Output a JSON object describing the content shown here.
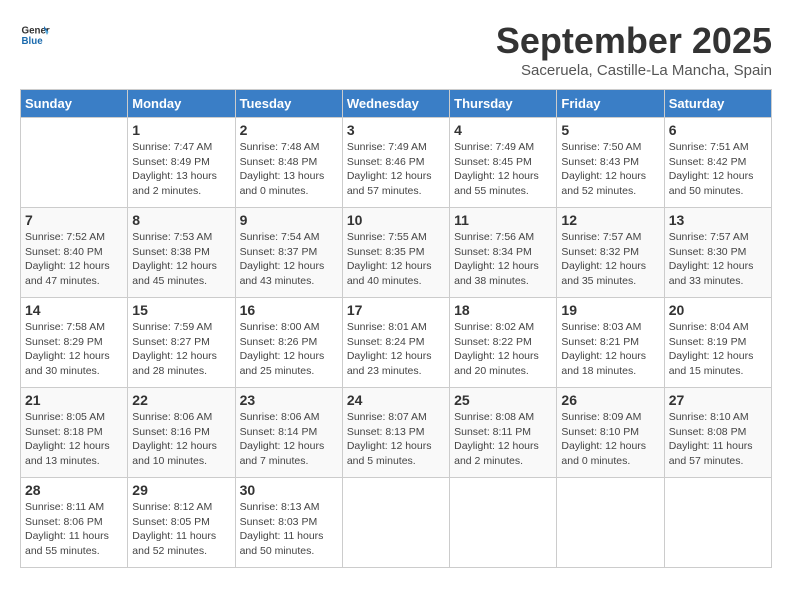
{
  "logo": {
    "line1": "General",
    "line2": "Blue"
  },
  "title": "September 2025",
  "subtitle": "Saceruela, Castille-La Mancha, Spain",
  "days_of_week": [
    "Sunday",
    "Monday",
    "Tuesday",
    "Wednesday",
    "Thursday",
    "Friday",
    "Saturday"
  ],
  "weeks": [
    [
      {
        "day": "",
        "info": ""
      },
      {
        "day": "1",
        "info": "Sunrise: 7:47 AM\nSunset: 8:49 PM\nDaylight: 13 hours\nand 2 minutes."
      },
      {
        "day": "2",
        "info": "Sunrise: 7:48 AM\nSunset: 8:48 PM\nDaylight: 13 hours\nand 0 minutes."
      },
      {
        "day": "3",
        "info": "Sunrise: 7:49 AM\nSunset: 8:46 PM\nDaylight: 12 hours\nand 57 minutes."
      },
      {
        "day": "4",
        "info": "Sunrise: 7:49 AM\nSunset: 8:45 PM\nDaylight: 12 hours\nand 55 minutes."
      },
      {
        "day": "5",
        "info": "Sunrise: 7:50 AM\nSunset: 8:43 PM\nDaylight: 12 hours\nand 52 minutes."
      },
      {
        "day": "6",
        "info": "Sunrise: 7:51 AM\nSunset: 8:42 PM\nDaylight: 12 hours\nand 50 minutes."
      }
    ],
    [
      {
        "day": "7",
        "info": "Sunrise: 7:52 AM\nSunset: 8:40 PM\nDaylight: 12 hours\nand 47 minutes."
      },
      {
        "day": "8",
        "info": "Sunrise: 7:53 AM\nSunset: 8:38 PM\nDaylight: 12 hours\nand 45 minutes."
      },
      {
        "day": "9",
        "info": "Sunrise: 7:54 AM\nSunset: 8:37 PM\nDaylight: 12 hours\nand 43 minutes."
      },
      {
        "day": "10",
        "info": "Sunrise: 7:55 AM\nSunset: 8:35 PM\nDaylight: 12 hours\nand 40 minutes."
      },
      {
        "day": "11",
        "info": "Sunrise: 7:56 AM\nSunset: 8:34 PM\nDaylight: 12 hours\nand 38 minutes."
      },
      {
        "day": "12",
        "info": "Sunrise: 7:57 AM\nSunset: 8:32 PM\nDaylight: 12 hours\nand 35 minutes."
      },
      {
        "day": "13",
        "info": "Sunrise: 7:57 AM\nSunset: 8:30 PM\nDaylight: 12 hours\nand 33 minutes."
      }
    ],
    [
      {
        "day": "14",
        "info": "Sunrise: 7:58 AM\nSunset: 8:29 PM\nDaylight: 12 hours\nand 30 minutes."
      },
      {
        "day": "15",
        "info": "Sunrise: 7:59 AM\nSunset: 8:27 PM\nDaylight: 12 hours\nand 28 minutes."
      },
      {
        "day": "16",
        "info": "Sunrise: 8:00 AM\nSunset: 8:26 PM\nDaylight: 12 hours\nand 25 minutes."
      },
      {
        "day": "17",
        "info": "Sunrise: 8:01 AM\nSunset: 8:24 PM\nDaylight: 12 hours\nand 23 minutes."
      },
      {
        "day": "18",
        "info": "Sunrise: 8:02 AM\nSunset: 8:22 PM\nDaylight: 12 hours\nand 20 minutes."
      },
      {
        "day": "19",
        "info": "Sunrise: 8:03 AM\nSunset: 8:21 PM\nDaylight: 12 hours\nand 18 minutes."
      },
      {
        "day": "20",
        "info": "Sunrise: 8:04 AM\nSunset: 8:19 PM\nDaylight: 12 hours\nand 15 minutes."
      }
    ],
    [
      {
        "day": "21",
        "info": "Sunrise: 8:05 AM\nSunset: 8:18 PM\nDaylight: 12 hours\nand 13 minutes."
      },
      {
        "day": "22",
        "info": "Sunrise: 8:06 AM\nSunset: 8:16 PM\nDaylight: 12 hours\nand 10 minutes."
      },
      {
        "day": "23",
        "info": "Sunrise: 8:06 AM\nSunset: 8:14 PM\nDaylight: 12 hours\nand 7 minutes."
      },
      {
        "day": "24",
        "info": "Sunrise: 8:07 AM\nSunset: 8:13 PM\nDaylight: 12 hours\nand 5 minutes."
      },
      {
        "day": "25",
        "info": "Sunrise: 8:08 AM\nSunset: 8:11 PM\nDaylight: 12 hours\nand 2 minutes."
      },
      {
        "day": "26",
        "info": "Sunrise: 8:09 AM\nSunset: 8:10 PM\nDaylight: 12 hours\nand 0 minutes."
      },
      {
        "day": "27",
        "info": "Sunrise: 8:10 AM\nSunset: 8:08 PM\nDaylight: 11 hours\nand 57 minutes."
      }
    ],
    [
      {
        "day": "28",
        "info": "Sunrise: 8:11 AM\nSunset: 8:06 PM\nDaylight: 11 hours\nand 55 minutes."
      },
      {
        "day": "29",
        "info": "Sunrise: 8:12 AM\nSunset: 8:05 PM\nDaylight: 11 hours\nand 52 minutes."
      },
      {
        "day": "30",
        "info": "Sunrise: 8:13 AM\nSunset: 8:03 PM\nDaylight: 11 hours\nand 50 minutes."
      },
      {
        "day": "",
        "info": ""
      },
      {
        "day": "",
        "info": ""
      },
      {
        "day": "",
        "info": ""
      },
      {
        "day": "",
        "info": ""
      }
    ]
  ]
}
